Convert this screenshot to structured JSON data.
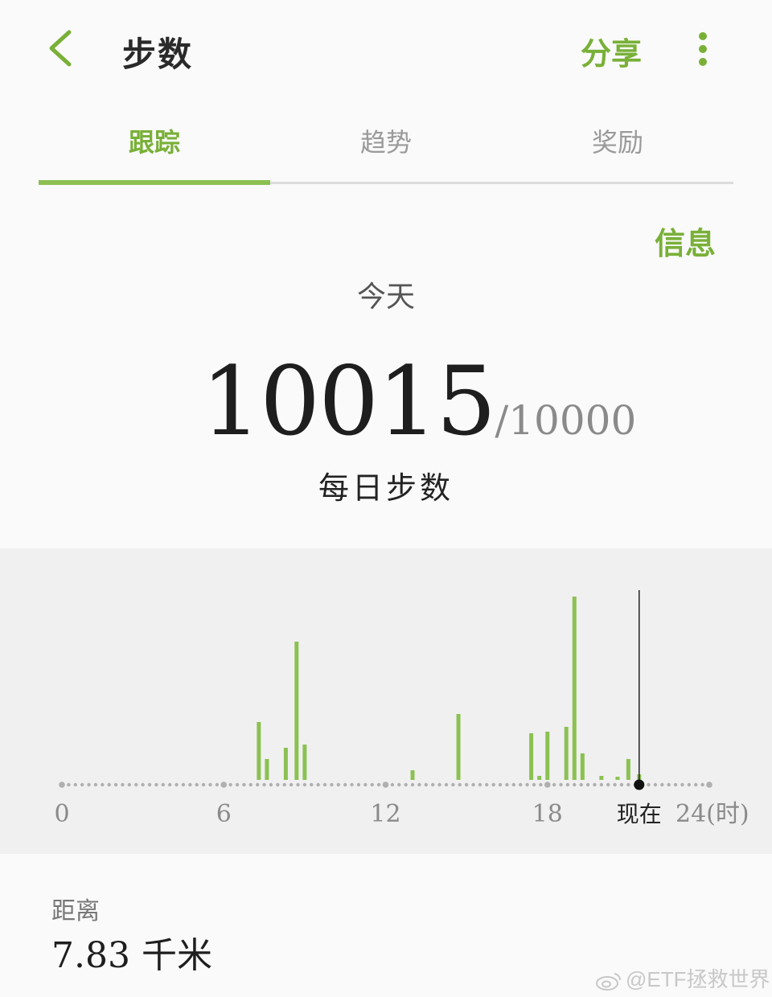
{
  "header": {
    "title": "步数",
    "share_label": "分享",
    "icons": {
      "back": "chevron-left-icon",
      "more": "more-vertical-icon"
    }
  },
  "tabs": [
    {
      "label": "跟踪",
      "active": true
    },
    {
      "label": "趋势",
      "active": false
    },
    {
      "label": "奖励",
      "active": false
    }
  ],
  "info_label": "信息",
  "summary": {
    "period": "今天",
    "steps": "10015",
    "goal": "/10000",
    "label": "每日步数"
  },
  "chart_data": {
    "type": "bar",
    "xlabel": "",
    "ylabel": "",
    "x_ticks": [
      {
        "label": "0",
        "x": 0
      },
      {
        "label": "6",
        "x": 6
      },
      {
        "label": "12",
        "x": 12
      },
      {
        "label": "18",
        "x": 18
      },
      {
        "label": "24(时)",
        "x": 24
      }
    ],
    "xlim": [
      0,
      24
    ],
    "now_label": "现在",
    "now_hour": 21.4,
    "bars": [
      {
        "x": 7.3,
        "v": 72
      },
      {
        "x": 7.6,
        "v": 26
      },
      {
        "x": 8.3,
        "v": 40
      },
      {
        "x": 8.7,
        "v": 172
      },
      {
        "x": 9.0,
        "v": 44
      },
      {
        "x": 13.0,
        "v": 12
      },
      {
        "x": 14.7,
        "v": 82
      },
      {
        "x": 17.4,
        "v": 58
      },
      {
        "x": 17.7,
        "v": 5
      },
      {
        "x": 18.0,
        "v": 60
      },
      {
        "x": 18.7,
        "v": 66
      },
      {
        "x": 19.0,
        "v": 228
      },
      {
        "x": 19.3,
        "v": 33
      },
      {
        "x": 20.0,
        "v": 5
      },
      {
        "x": 20.6,
        "v": 4
      },
      {
        "x": 21.0,
        "v": 26
      },
      {
        "x": 21.4,
        "v": 7
      }
    ],
    "bar_color": "#8cc152",
    "grid": false
  },
  "distance": {
    "label": "距离",
    "value": "7.83 千米"
  },
  "watermark": "@ETF拯救世界",
  "colors": {
    "accent": "#79b038",
    "bar": "#8cc152",
    "chart_bg": "#f0f0f0"
  }
}
